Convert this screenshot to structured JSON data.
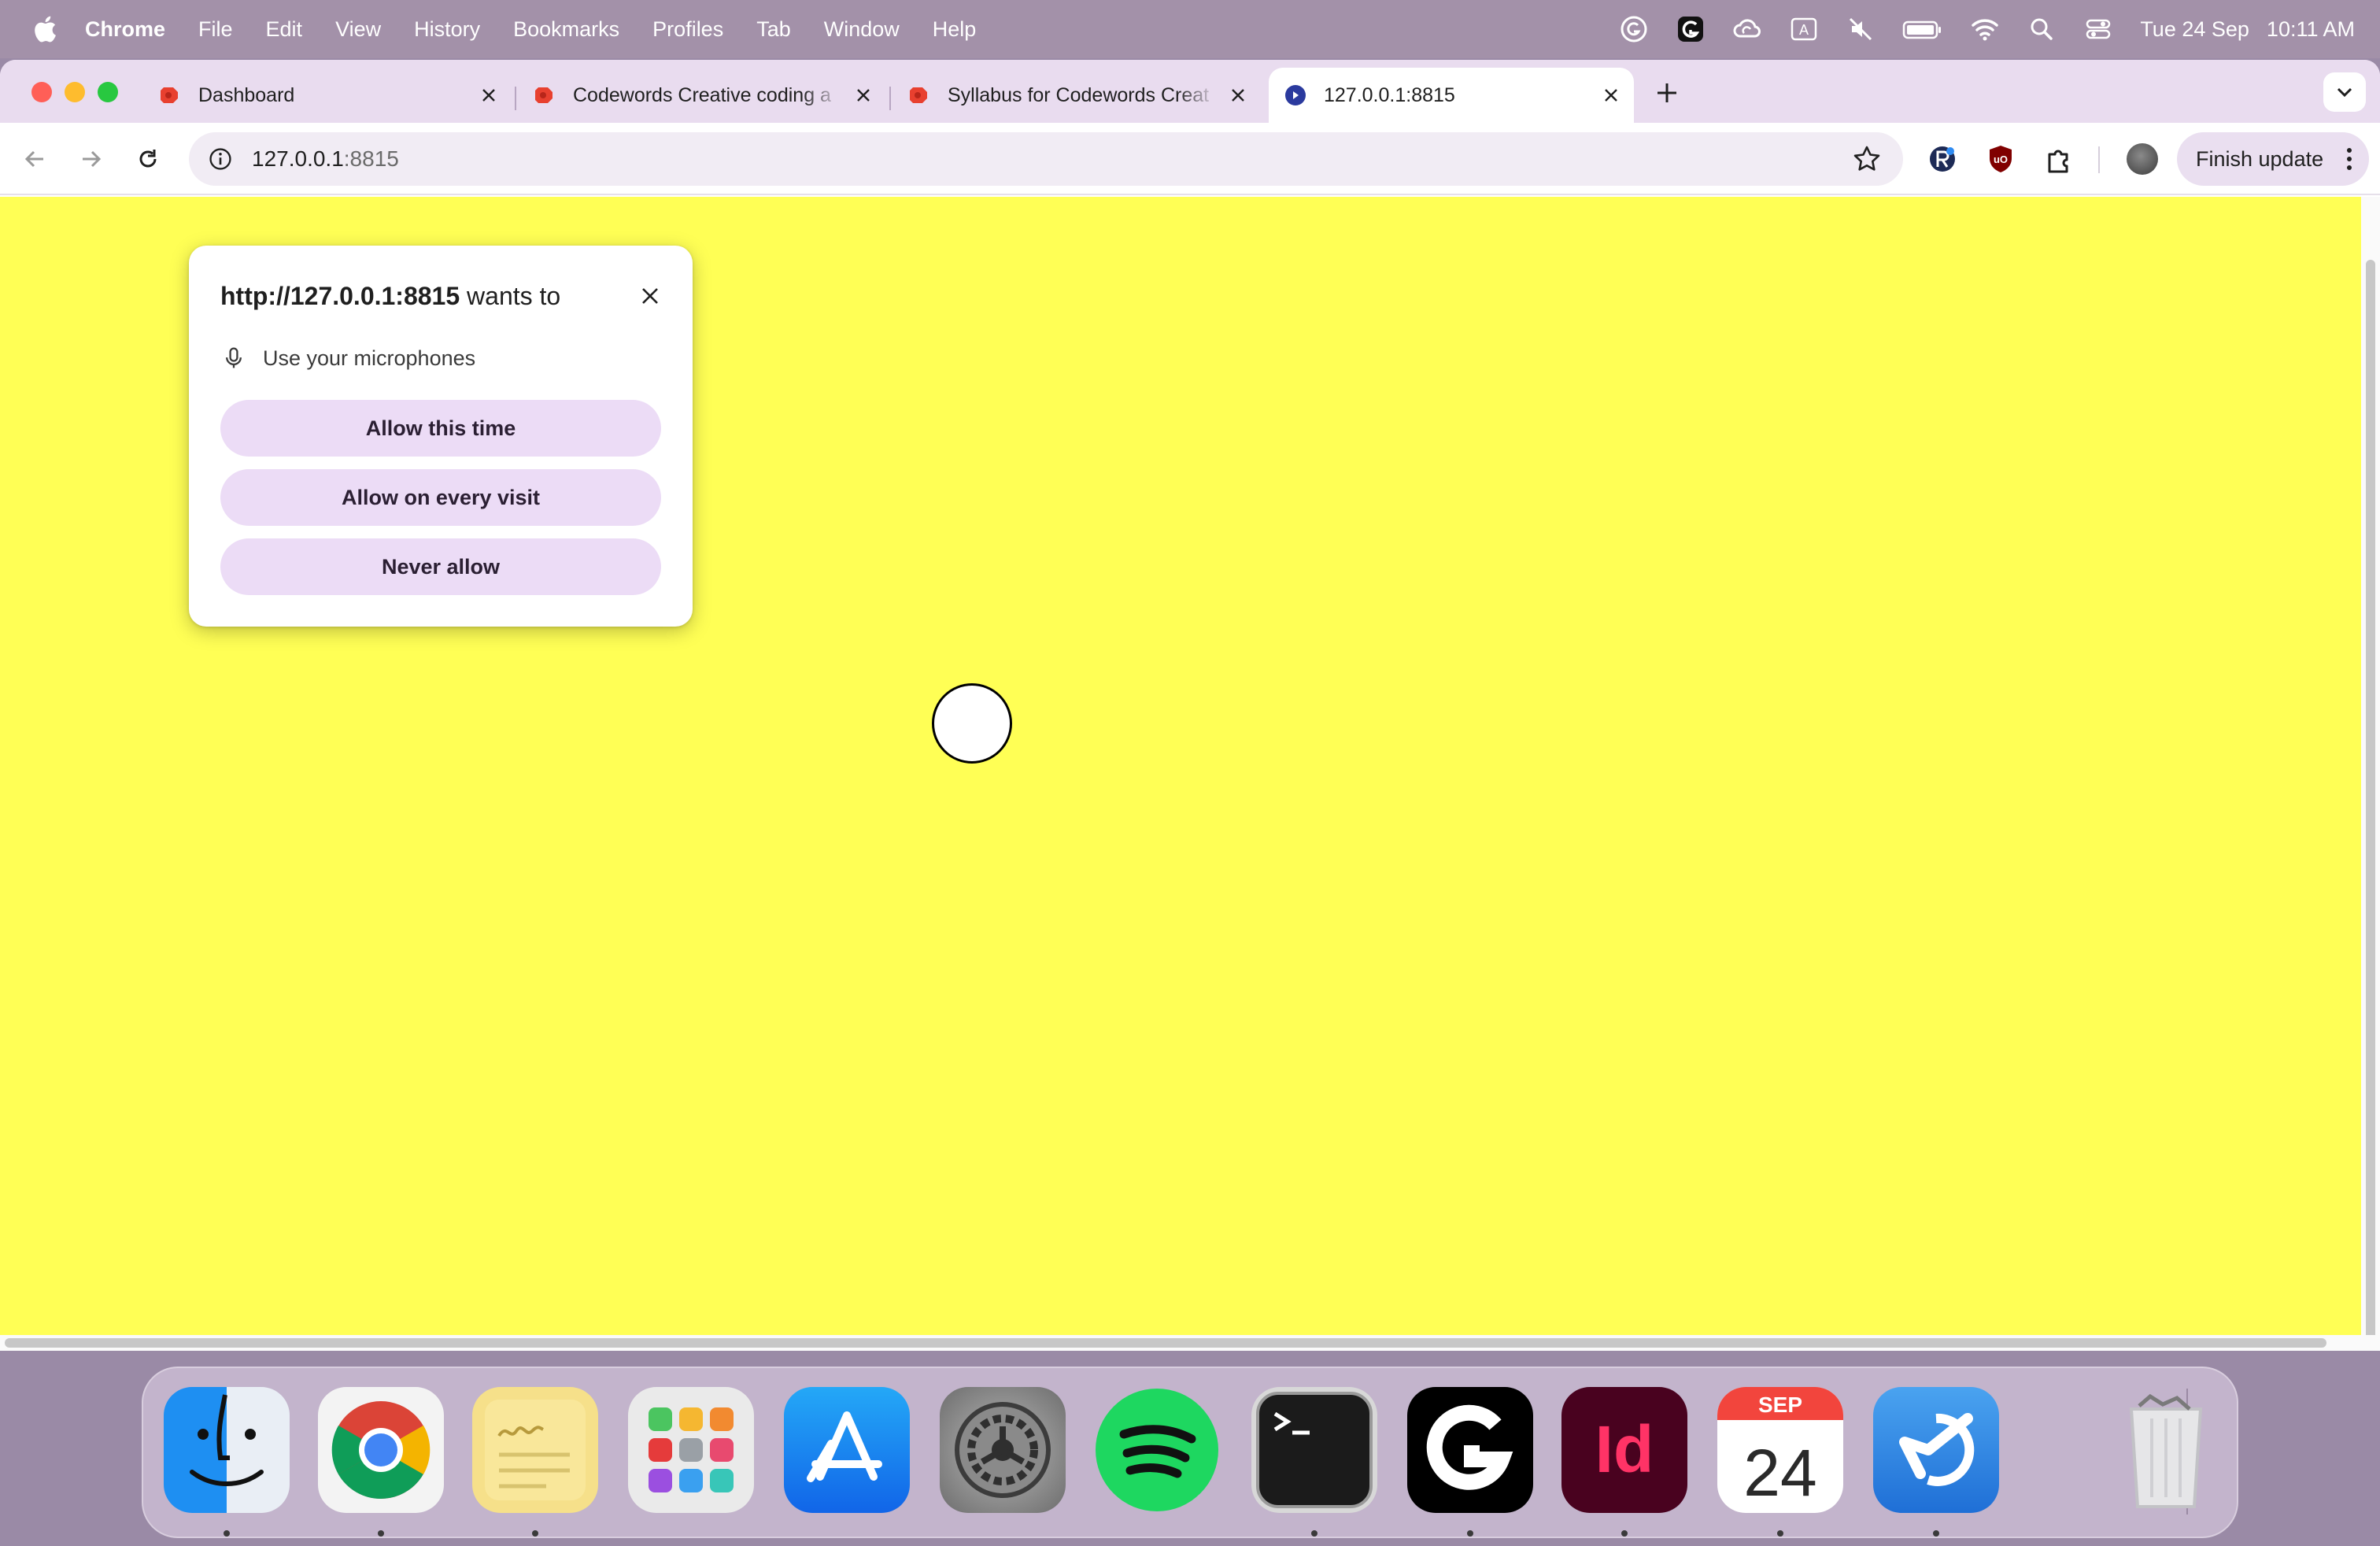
{
  "menubar": {
    "apple_icon": "apple-icon",
    "items": [
      {
        "label": "Chrome",
        "bold": true
      },
      {
        "label": "File"
      },
      {
        "label": "Edit"
      },
      {
        "label": "View"
      },
      {
        "label": "History"
      },
      {
        "label": "Bookmarks"
      },
      {
        "label": "Profiles"
      },
      {
        "label": "Tab"
      },
      {
        "label": "Window"
      },
      {
        "label": "Help"
      }
    ],
    "status_icons": [
      "grammarly-icon",
      "logitech-g-icon",
      "creative-cloud-icon",
      "input-source-icon",
      "mute-icon",
      "battery-icon",
      "wifi-icon",
      "spotlight-search-icon",
      "control-center-icon"
    ],
    "input_source_label": "A",
    "date": "Tue 24 Sep",
    "time": "10:11 AM"
  },
  "tabs": [
    {
      "title": "Dashboard",
      "favicon": "red-app-favicon",
      "active": false
    },
    {
      "title": "Codewords Creative coding a",
      "favicon": "red-app-favicon",
      "active": false
    },
    {
      "title": "Syllabus for Codewords Creat",
      "favicon": "red-app-favicon",
      "active": false
    },
    {
      "title": "127.0.0.1:8815",
      "favicon": "blue-circle-favicon",
      "active": true
    }
  ],
  "toolbar": {
    "url_host": "127.0.0.1",
    "url_port": ":8815",
    "finish_update_label": "Finish update",
    "extensions": [
      "extension-r-icon",
      "ublock-origin-icon",
      "extensions-puzzle-icon"
    ]
  },
  "popup": {
    "origin": "http://127.0.0.1:8815",
    "wants_to": " wants to",
    "permission": "Use your microphones",
    "buttons": {
      "allow_once": "Allow this time",
      "allow_always": "Allow on every visit",
      "never": "Never allow"
    }
  },
  "page": {
    "background_color": "#ffff55"
  },
  "colors": {
    "accent": "#ecdcf6",
    "tabstrip": "#e9dcef",
    "menubar": "#a391a9"
  },
  "dock": {
    "apps": [
      {
        "name": "Finder",
        "running": true
      },
      {
        "name": "Google Chrome",
        "running": true
      },
      {
        "name": "Stickies",
        "running": true
      },
      {
        "name": "Launchpad",
        "running": false
      },
      {
        "name": "App Store",
        "running": false
      },
      {
        "name": "System Settings",
        "running": false
      },
      {
        "name": "Spotify",
        "running": false
      },
      {
        "name": "Terminal",
        "running": true
      },
      {
        "name": "Logitech G HUB",
        "running": true
      },
      {
        "name": "Adobe InDesign",
        "running": true
      },
      {
        "name": "Calendar",
        "running": true
      },
      {
        "name": "Code Editor",
        "running": true
      }
    ],
    "calendar_month": "SEP",
    "calendar_day": "24",
    "indesign_label": "Id",
    "trash": "Trash"
  }
}
